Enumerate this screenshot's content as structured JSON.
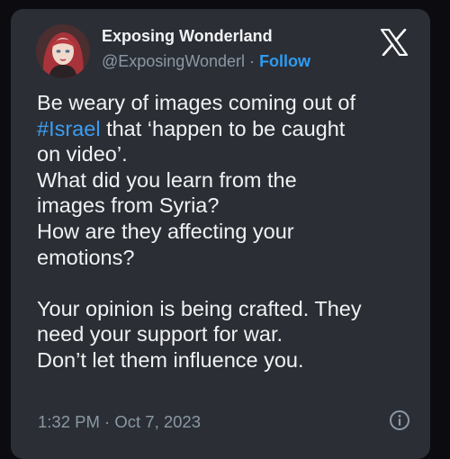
{
  "author": {
    "name": "Exposing Wonderland",
    "handle": "@ExposingWonderl",
    "separator": "·",
    "follow_label": "Follow"
  },
  "icons": {
    "logo": "x-logo-icon",
    "info": "info-icon",
    "avatar": "avatar-portrait"
  },
  "tweet": {
    "line1": "Be weary of images coming out of",
    "hashtag": "#Israel",
    "line2_rest": " that ‘happen to be caught",
    "line3": "on video’.",
    "line4": "What did you learn from the",
    "line5": "images from Syria?",
    "line6": "How are they affecting your",
    "line7": "emotions?",
    "line8": "Your opinion is being crafted. They",
    "line9": "need your support for war.",
    "line10": "Don’t let them influence you."
  },
  "meta": {
    "time": "1:32 PM",
    "separator": "·",
    "date": "Oct 7, 2023"
  },
  "colors": {
    "card_bg": "#2b2f35",
    "page_bg": "#0c0c10",
    "text": "#f1f2f4",
    "muted": "#8b98a5",
    "link": "#2f9bf0"
  }
}
